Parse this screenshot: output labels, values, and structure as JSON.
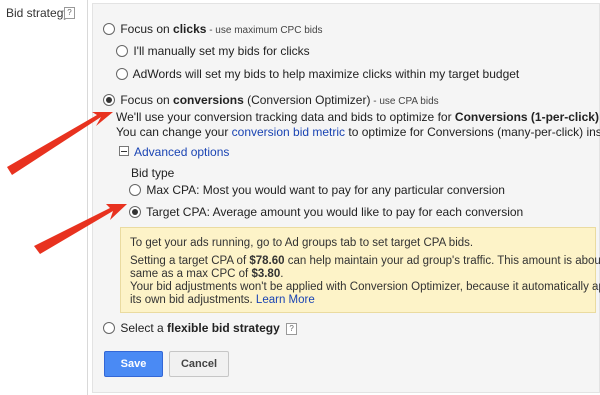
{
  "left_label": "Bid strategy",
  "help": "?",
  "options": {
    "clicks": {
      "prefix": "Focus on ",
      "bold": "clicks",
      "suffix": " - use maximum CPC bids"
    },
    "clicks_manual": "I'll manually set my bids for clicks",
    "clicks_auto": "AdWords will set my bids to help maximize clicks within my target budget",
    "conversions": {
      "prefix": "Focus on ",
      "bold": "conversions",
      "middle": " (Conversion Optimizer)",
      "suffix": " - use CPA bids"
    },
    "conv_desc1": {
      "text": "We'll use your conversion tracking data and bids to optimize for ",
      "bold": "Conversions (1-per-click)",
      "end": "."
    },
    "conv_desc2": {
      "prefix": "You can change your ",
      "link": "conversion bid metric",
      "suffix": " to optimize for Conversions (many-per-click) instead."
    },
    "advanced": "Advanced options",
    "bid_type": "Bid type",
    "max_cpa": "Max CPA: Most you would want to pay for any particular conversion",
    "target_cpa": "Target CPA: Average amount you would like to pay for each conversion",
    "flexible": {
      "prefix": "Select a ",
      "bold": "flexible bid strategy"
    }
  },
  "notice": {
    "line1": "To get your ads running, go to Ad groups tab to set target CPA bids.",
    "line2a": {
      "prefix": "Setting a target CPA of ",
      "bold": "$78.60",
      "suffix": " can help maintain your ad group's traffic. This amount is about the"
    },
    "line2b": {
      "prefix": "same as a max CPC of ",
      "bold": "$3.80",
      "end": "."
    },
    "line3a": "Your bid adjustments won't be applied with Conversion Optimizer, because it automatically applies",
    "line3b": {
      "prefix": "its own bid adjustments. ",
      "link": "Learn More"
    }
  },
  "buttons": {
    "save": "Save",
    "cancel": "Cancel"
  },
  "colors": {
    "arrow": "#e8321f",
    "save_button": "#4a8af4",
    "link": "#1a44b3",
    "notice_bg": "#fdf3c8"
  }
}
